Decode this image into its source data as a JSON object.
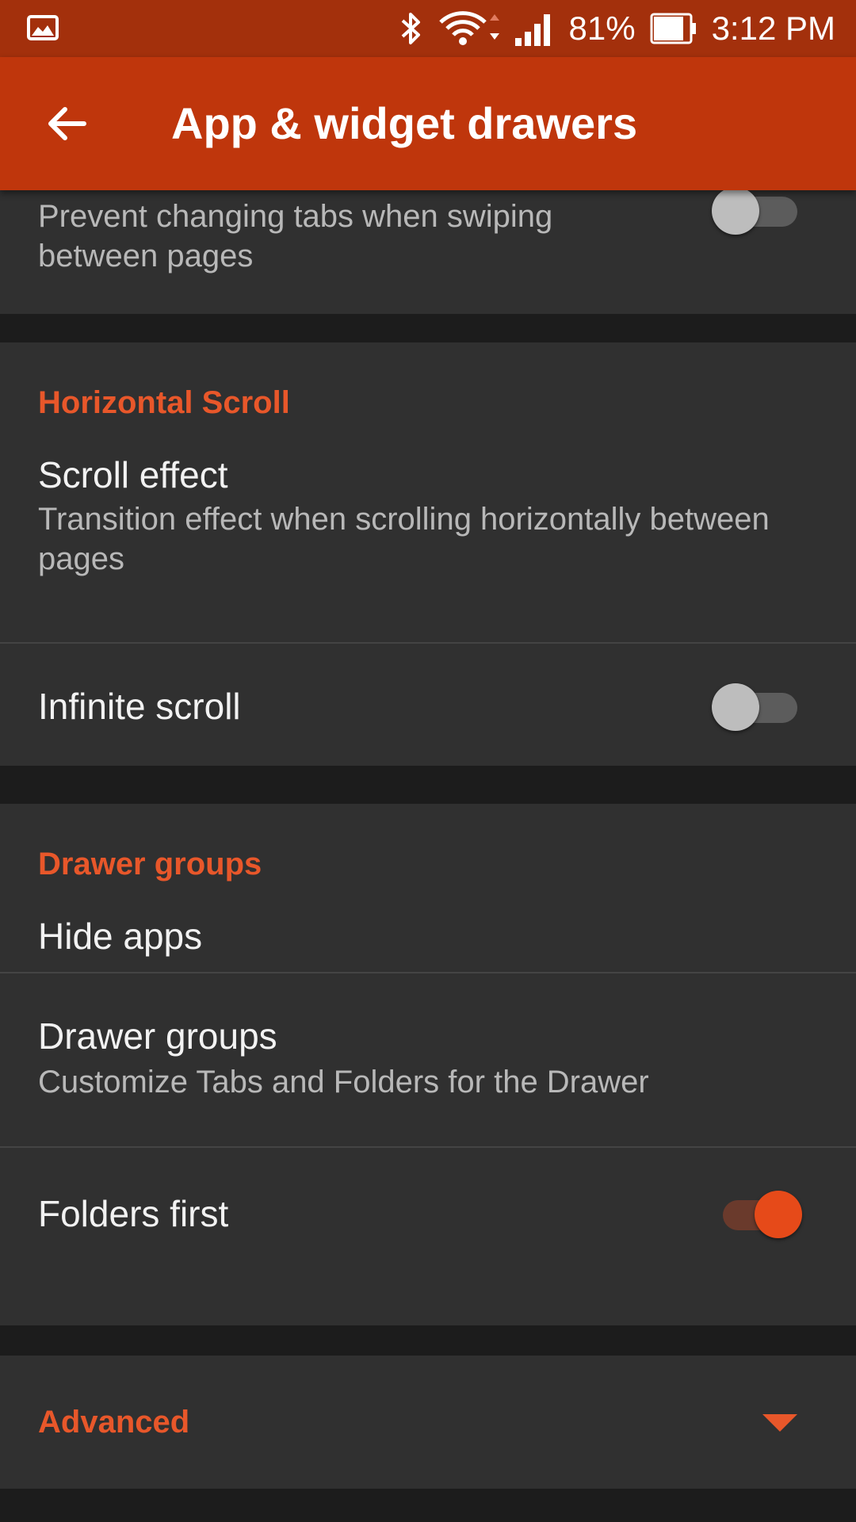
{
  "status_bar": {
    "battery_percent": "81%",
    "time": "3:12 PM",
    "icons": [
      "image-notification-icon",
      "bluetooth-icon",
      "wifi-icon",
      "signal-icon",
      "battery-icon"
    ]
  },
  "app_bar": {
    "title": "App & widget drawers",
    "back_icon": "arrow-back-icon",
    "color": "#bf360c"
  },
  "partial_item": {
    "summary": "Prevent changing tabs when swiping between pages",
    "switch_on": false
  },
  "horizontal_scroll": {
    "header": "Horizontal Scroll",
    "scroll_effect": {
      "title": "Scroll effect",
      "summary": "Transition effect when scrolling horizontally between pages"
    },
    "infinite_scroll": {
      "title": "Infinite scroll",
      "switch_on": false
    }
  },
  "drawer_groups": {
    "header": "Drawer groups",
    "hide_apps": {
      "title": "Hide apps"
    },
    "drawer_groups_item": {
      "title": "Drawer groups",
      "summary": "Customize Tabs and Folders for the Drawer"
    },
    "folders_first": {
      "title": "Folders first",
      "switch_on": true
    }
  },
  "advanced": {
    "header": "Advanced",
    "expand_icon": "triangle-down-icon"
  },
  "colors": {
    "accent": "#e8572a",
    "card_bg": "#303030",
    "page_bg": "#1c1c1c"
  }
}
